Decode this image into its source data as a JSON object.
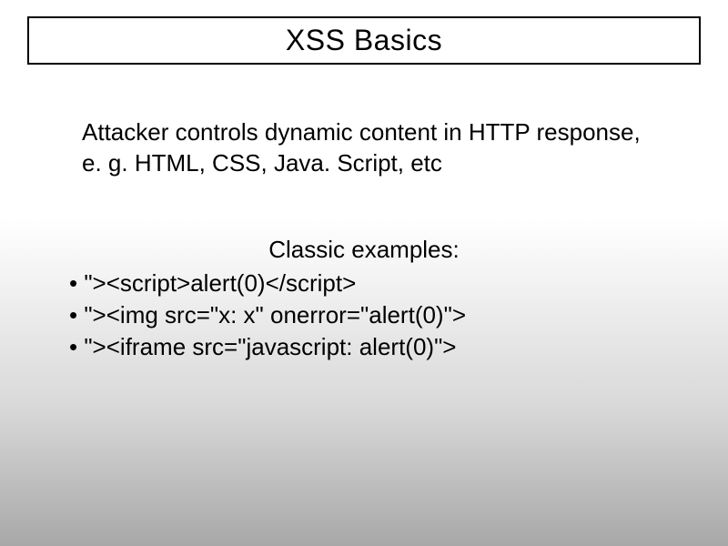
{
  "title": "XSS Basics",
  "description": "Attacker controls dynamic content in HTTP response, e. g. HTML, CSS, Java. Script, etc",
  "examples_heading": "Classic examples:",
  "examples": [
    "• \"><script>alert(0)</script>",
    "• \"><img src=\"x: x\" onerror=\"alert(0)\">",
    "• \"><iframe src=\"javascript: alert(0)\">"
  ]
}
